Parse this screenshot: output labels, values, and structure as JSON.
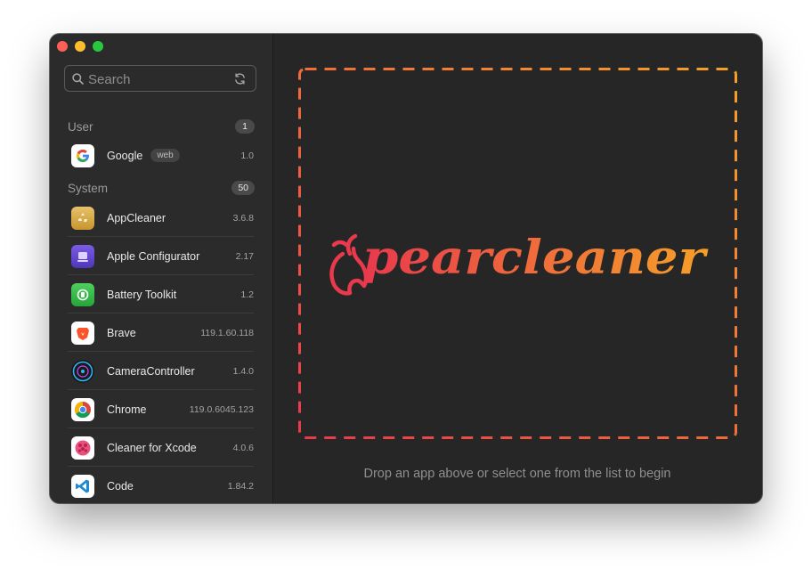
{
  "search": {
    "placeholder": "Search"
  },
  "sections": [
    {
      "label": "User",
      "count": "1"
    },
    {
      "label": "System",
      "count": "50"
    }
  ],
  "user_apps": [
    {
      "name": "Google",
      "tag": "web",
      "version": "1.0",
      "icon": "google-icon"
    }
  ],
  "system_apps": [
    {
      "name": "AppCleaner",
      "version": "3.6.8",
      "icon": "appcleaner-icon"
    },
    {
      "name": "Apple Configurator",
      "version": "2.17",
      "icon": "apple-configurator-icon"
    },
    {
      "name": "Battery Toolkit",
      "version": "1.2",
      "icon": "battery-toolkit-icon"
    },
    {
      "name": "Brave",
      "version": "119.1.60.118",
      "icon": "brave-icon"
    },
    {
      "name": "CameraController",
      "version": "1.4.0",
      "icon": "camera-controller-icon"
    },
    {
      "name": "Chrome",
      "version": "119.0.6045.123",
      "icon": "chrome-icon"
    },
    {
      "name": "Cleaner for Xcode",
      "version": "4.0.6",
      "icon": "cleaner-for-xcode-icon"
    },
    {
      "name": "Code",
      "version": "1.84.2",
      "icon": "vscode-icon"
    }
  ],
  "main": {
    "logo_text": "pearcleaner",
    "hint": "Drop an app above or select one from the list to begin"
  },
  "colors": {
    "gradient_start": "#e8394d",
    "gradient_end": "#f6a028",
    "window_bg": "#262626",
    "sidebar_bg": "#2b2b2b"
  }
}
